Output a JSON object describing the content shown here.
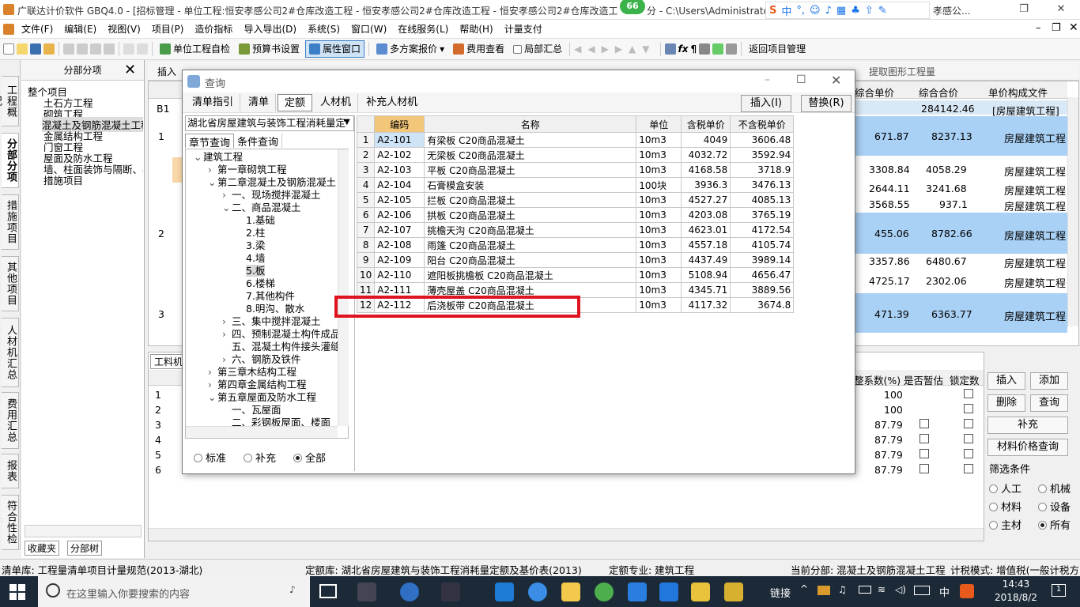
{
  "window": {
    "title": "广联达计价软件 GBQ4.0 - [招标管理 - 单位工程:恒安孝感公司2#仓库改造工程 - 恒安孝感公司2#仓库改造工程 - 恒安孝感公司2#仓库改造工程",
    "title_tail": "分 - C:\\Users\\Administrato",
    "title_right": "孝感公...",
    "badge": "66",
    "ime_label": "中"
  },
  "menu": [
    "文件(F)",
    "编辑(E)",
    "视图(V)",
    "项目(P)",
    "造价指标",
    "导入导出(D)",
    "系统(S)",
    "窗口(W)",
    "在线服务(L)",
    "帮助(H)",
    "计量支付"
  ],
  "toolbar": {
    "selfcheck": "单位工程自检",
    "budget_setting": "预算书设置",
    "attr_window": "属性窗口",
    "multi_plan": "多方案报价",
    "fee_view": "费用查看",
    "partial_sum": "局部汇总",
    "back_project": "返回项目管理",
    "extract": "提取图形工程量",
    "insert": "插入"
  },
  "left_tabs": [
    "工程概况",
    "分部分项",
    "措施项目",
    "其他项目",
    "人材机汇总",
    "费用汇总",
    "报表",
    "符合性检查"
  ],
  "fenbu_panel": {
    "header": "分部分项",
    "items": [
      "整个项目",
      "土石方工程",
      "砌筑工程",
      "混凝土及钢筋混凝土工程",
      "金属结构工程",
      "门窗工程",
      "屋面及防水工程",
      "墙、柱面装饰与隔断、幕",
      "措施项目"
    ],
    "bottom_tabs": [
      "收藏夹",
      "分部树"
    ]
  },
  "main_grid": {
    "headers": [
      "综合单价",
      "综合合价",
      "单价构成文件"
    ],
    "row_b1": {
      "label": "B1",
      "total": "284142.46",
      "file": "[房屋建筑工程]"
    },
    "rows": [
      {
        "no": "1",
        "price": "671.87",
        "total": "8237.13",
        "file": "房屋建筑工程"
      },
      {
        "no": "",
        "price": "3308.84",
        "total": "4058.29",
        "file": "房屋建筑工程"
      },
      {
        "no": "",
        "price": "2644.11",
        "total": "3241.68",
        "file": "房屋建筑工程"
      },
      {
        "no": "",
        "price": "3568.55",
        "total": "937.1",
        "file": "房屋建筑工程"
      },
      {
        "no": "2",
        "price": "455.06",
        "total": "8782.66",
        "file": "房屋建筑工程"
      },
      {
        "no": "",
        "price": "3357.86",
        "total": "6480.67",
        "file": "房屋建筑工程"
      },
      {
        "no": "",
        "price": "4725.17",
        "total": "2302.06",
        "file": "房屋建筑工程"
      },
      {
        "no": "3",
        "price": "471.39",
        "total": "6363.77",
        "file": "房屋建筑工程"
      }
    ]
  },
  "lower_grid": {
    "tab": "工料机",
    "headers": [
      "整系数(%)",
      "是否暂估",
      "锁定数"
    ],
    "rows": [
      {
        "no": "1",
        "coef": "100"
      },
      {
        "no": "2",
        "coef": "100"
      },
      {
        "no": "3",
        "coef": "87.79"
      },
      {
        "no": "4",
        "coef": "87.79"
      },
      {
        "no": "5",
        "coef": "87.79"
      },
      {
        "no": "6",
        "coef": "87.79"
      }
    ]
  },
  "right_panel": {
    "buttons": [
      "插入",
      "添加",
      "删除",
      "查询",
      "补充",
      "材料价格查询"
    ],
    "filter_title": "筛选条件",
    "filters": [
      "人工",
      "机械",
      "材料",
      "设备",
      "主材",
      "所有"
    ],
    "filter_selected": "所有"
  },
  "dialog": {
    "title": "查询",
    "tabs": [
      "清单指引",
      "清单",
      "定额",
      "人材机",
      "补充人材机"
    ],
    "selected_tab": "定额",
    "insert_btn": "插入(I)",
    "replace_btn": "替换(R)",
    "library": "湖北省房屋建筑与装饰工程消耗量定",
    "subtabs": [
      "章节查询",
      "条件查询"
    ],
    "tree": [
      {
        "t": "建筑工程",
        "lvl": 0,
        "exp": "v"
      },
      {
        "t": "第一章砌筑工程",
        "lvl": 1,
        "exp": ">"
      },
      {
        "t": "第二章混凝土及钢筋混凝土",
        "lvl": 1,
        "exp": "v"
      },
      {
        "t": "一、现场搅拌混凝土",
        "lvl": 2,
        "exp": ">"
      },
      {
        "t": "二、商品混凝土",
        "lvl": 2,
        "exp": "v"
      },
      {
        "t": "1.基础",
        "lvl": 3,
        "exp": ""
      },
      {
        "t": "2.柱",
        "lvl": 3,
        "exp": ""
      },
      {
        "t": "3.梁",
        "lvl": 3,
        "exp": ""
      },
      {
        "t": "4.墙",
        "lvl": 3,
        "exp": ""
      },
      {
        "t": "5.板",
        "lvl": 3,
        "exp": "",
        "sel": true
      },
      {
        "t": "6.楼梯",
        "lvl": 3,
        "exp": ""
      },
      {
        "t": "7.其他构件",
        "lvl": 3,
        "exp": ""
      },
      {
        "t": "8.明沟、散水",
        "lvl": 3,
        "exp": ""
      },
      {
        "t": "三、集中搅拌混凝土",
        "lvl": 2,
        "exp": ">"
      },
      {
        "t": "四、预制混凝土构件成品",
        "lvl": 2,
        "exp": ">"
      },
      {
        "t": "五、混凝土构件接头灌缝",
        "lvl": 2,
        "exp": ""
      },
      {
        "t": "六、钢筋及铁件",
        "lvl": 2,
        "exp": ">"
      },
      {
        "t": "第三章木结构工程",
        "lvl": 1,
        "exp": ">"
      },
      {
        "t": "第四章金属结构工程",
        "lvl": 1,
        "exp": ">"
      },
      {
        "t": "第五章屋面及防水工程",
        "lvl": 1,
        "exp": "v"
      },
      {
        "t": "一、瓦屋面",
        "lvl": 2,
        "exp": ""
      },
      {
        "t": "二、彩钢板屋面、楼面",
        "lvl": 2,
        "exp": ""
      }
    ],
    "radios": [
      "标准",
      "补充",
      "全部"
    ],
    "radio_selected": "全部",
    "table_headers": [
      "编码",
      "名称",
      "单位",
      "含税单价",
      "不含税单价"
    ],
    "rows": [
      {
        "no": "1",
        "code": "A2-101",
        "name": "有梁板 C20商品混凝土",
        "unit": "10m3",
        "tax": "4049",
        "notax": "3606.48"
      },
      {
        "no": "2",
        "code": "A2-102",
        "name": "无梁板 C20商品混凝土",
        "unit": "10m3",
        "tax": "4032.72",
        "notax": "3592.94"
      },
      {
        "no": "3",
        "code": "A2-103",
        "name": "平板 C20商品混凝土",
        "unit": "10m3",
        "tax": "4168.58",
        "notax": "3718.9"
      },
      {
        "no": "4",
        "code": "A2-104",
        "name": "石膏模盒安装",
        "unit": "100块",
        "tax": "3936.3",
        "notax": "3476.13"
      },
      {
        "no": "5",
        "code": "A2-105",
        "name": "拦板 C20商品混凝土",
        "unit": "10m3",
        "tax": "4527.27",
        "notax": "4085.13"
      },
      {
        "no": "6",
        "code": "A2-106",
        "name": "拱板 C20商品混凝土",
        "unit": "10m3",
        "tax": "4203.08",
        "notax": "3765.19"
      },
      {
        "no": "7",
        "code": "A2-107",
        "name": "挑檐天沟 C20商品混凝土",
        "unit": "10m3",
        "tax": "4623.01",
        "notax": "4172.54"
      },
      {
        "no": "8",
        "code": "A2-108",
        "name": "雨篷 C20商品混凝土",
        "unit": "10m3",
        "tax": "4557.18",
        "notax": "4105.74"
      },
      {
        "no": "9",
        "code": "A2-109",
        "name": "阳台 C20商品混凝土",
        "unit": "10m3",
        "tax": "4437.49",
        "notax": "3989.14"
      },
      {
        "no": "10",
        "code": "A2-110",
        "name": "遮阳板挑檐板 C20商品混凝土",
        "unit": "10m3",
        "tax": "5108.94",
        "notax": "4656.47"
      },
      {
        "no": "11",
        "code": "A2-111",
        "name": "薄壳屋盖 C20商品混凝土",
        "unit": "10m3",
        "tax": "4345.71",
        "notax": "3889.56"
      },
      {
        "no": "12",
        "code": "A2-112",
        "name": "后浇板带 C20商品混凝土",
        "unit": "10m3",
        "tax": "4117.32",
        "notax": "3674.8"
      }
    ]
  },
  "status": {
    "list_lib": "清单库: 工程量清单项目计量规范(2013-湖北)",
    "quota_lib": "定额库: 湖北省房屋建筑与装饰工程消耗量定额及基价表(2013)",
    "quota_major": "定额专业: 建筑工程",
    "current_part": "当前分部: 混凝土及钢筋混凝土工程",
    "tax_mode": "计税模式: 增值税(一般计税方"
  },
  "taskbar": {
    "search_placeholder": "在这里输入你要搜索的内容",
    "tray_link": "链接",
    "ime": "中",
    "time": "14:43",
    "date": "2018/8/2",
    "notif": "1"
  },
  "colors": {
    "accent": "#3c7fc7",
    "highlight": "#e0141e",
    "selected_row": "#a9d0f5",
    "code_header": "#f3c77a"
  }
}
